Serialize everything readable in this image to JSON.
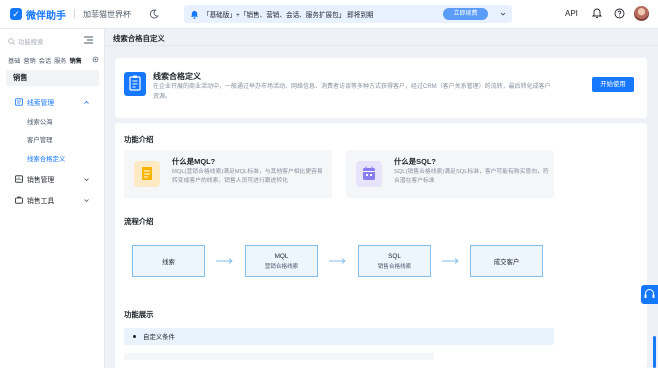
{
  "app": {
    "name": "微伴助手",
    "org_name": "加菲猫世界杯"
  },
  "banner": {
    "text": "「基础版」+「销售、营销、会话、服务扩展包」 即将到期",
    "button": "立即续费"
  },
  "topbar": {
    "api_label": "API"
  },
  "sidebar": {
    "search_placeholder": "功能搜索",
    "tabs": [
      "基础",
      "营销",
      "会话",
      "服务",
      "销售"
    ],
    "active_tab": "销售",
    "category": "销售",
    "groups": [
      {
        "label": "线索管理",
        "expanded": true,
        "items": [
          "线索公海",
          "客户管理",
          "线索合格定义"
        ]
      },
      {
        "label": "销售管理",
        "expanded": false,
        "items": []
      },
      {
        "label": "销售工具",
        "expanded": false,
        "items": []
      }
    ],
    "active_item": "线索合格定义"
  },
  "page": {
    "title": "线索合格自定义"
  },
  "hero": {
    "title": "线索合格定义",
    "desc": "在企业开展的商业活动中，一般通过举办市场活动、网络信息、消费者访谈等多种方式获得客户，经过CRM（客户关系管理）的流转，最后转化成客户资源。",
    "button": "开始使用"
  },
  "features": {
    "section_title": "功能介绍",
    "cards": [
      {
        "title": "什么是MQL?",
        "desc": "MQL(营销合格线索)满足MQL标准，与其他客户相比更容易转变成客户的线索，销售人员可进行跟进转化",
        "icon": "document-icon",
        "icon_bg": "#fde9c4",
        "icon_color": "#f7b500"
      },
      {
        "title": "什么是SQL?",
        "desc": "SQL(销售合格线索)满足SQL标准，客户可能有购买意向，符合潜在客户标准",
        "icon": "calendar-icon",
        "icon_bg": "#e6e3fb",
        "icon_color": "#8a7df0"
      }
    ]
  },
  "flow": {
    "section_title": "流程介绍",
    "steps": [
      {
        "name": "线索",
        "desc": ""
      },
      {
        "name": "MQL",
        "desc": "营销合格线索"
      },
      {
        "name": "SQL",
        "desc": "销售合格线索"
      },
      {
        "name": "成交客户",
        "desc": ""
      }
    ]
  },
  "showcase": {
    "section_title": "功能展示",
    "condition_label": "自定义条件"
  },
  "colors": {
    "primary": "#1677ff",
    "banner_bg": "#e8f1ff",
    "flow_bg": "#edf5fd",
    "flow_border": "#83bdea"
  }
}
